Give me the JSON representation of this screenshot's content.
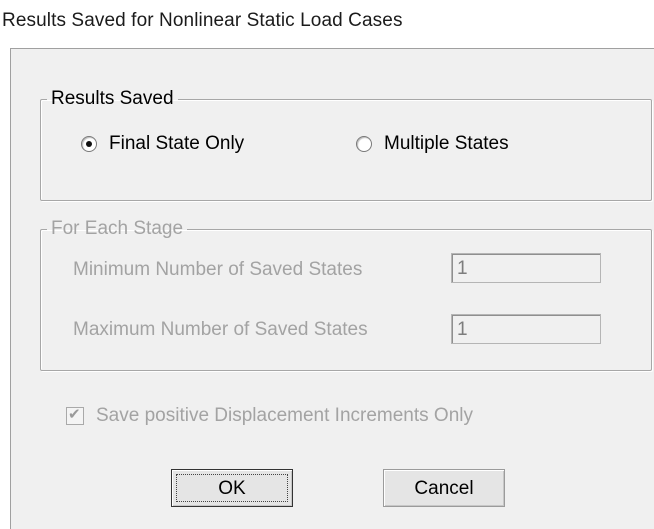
{
  "window": {
    "title": "Results Saved for Nonlinear Static Load Cases"
  },
  "results_saved": {
    "legend": "Results Saved",
    "options": [
      {
        "label": "Final State Only",
        "selected": true
      },
      {
        "label": "Multiple States",
        "selected": false
      }
    ]
  },
  "each_stage": {
    "legend": "For Each Stage",
    "min_label": "Minimum Number of Saved States",
    "min_value": "1",
    "max_label": "Maximum Number of Saved States",
    "max_value": "1"
  },
  "save_positive": {
    "label": "Save positive Displacement Increments Only",
    "checked": true
  },
  "buttons": {
    "ok": "OK",
    "cancel": "Cancel"
  }
}
